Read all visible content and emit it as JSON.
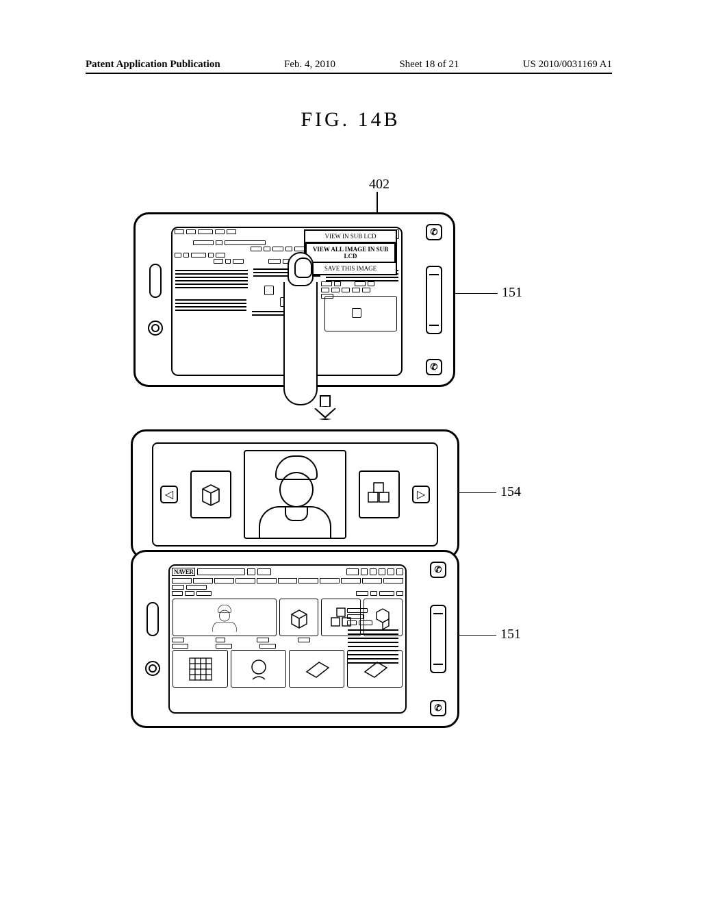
{
  "header": {
    "publication": "Patent Application Publication",
    "date": "Feb. 4, 2010",
    "sheet": "Sheet 18 of 21",
    "docnum": "US 2010/0031169 A1"
  },
  "figure_title": "FIG. 14B",
  "refs": {
    "r402": "402",
    "r151a": "151",
    "r154": "154",
    "r151b": "151"
  },
  "popup": {
    "item1": "VIEW IN SUB LCD",
    "item2": "VIEW ALL IMAGE IN SUB LCD",
    "item3": "SAVE THIS IMAGE"
  },
  "lower_screen": {
    "brand": "NAVER"
  }
}
